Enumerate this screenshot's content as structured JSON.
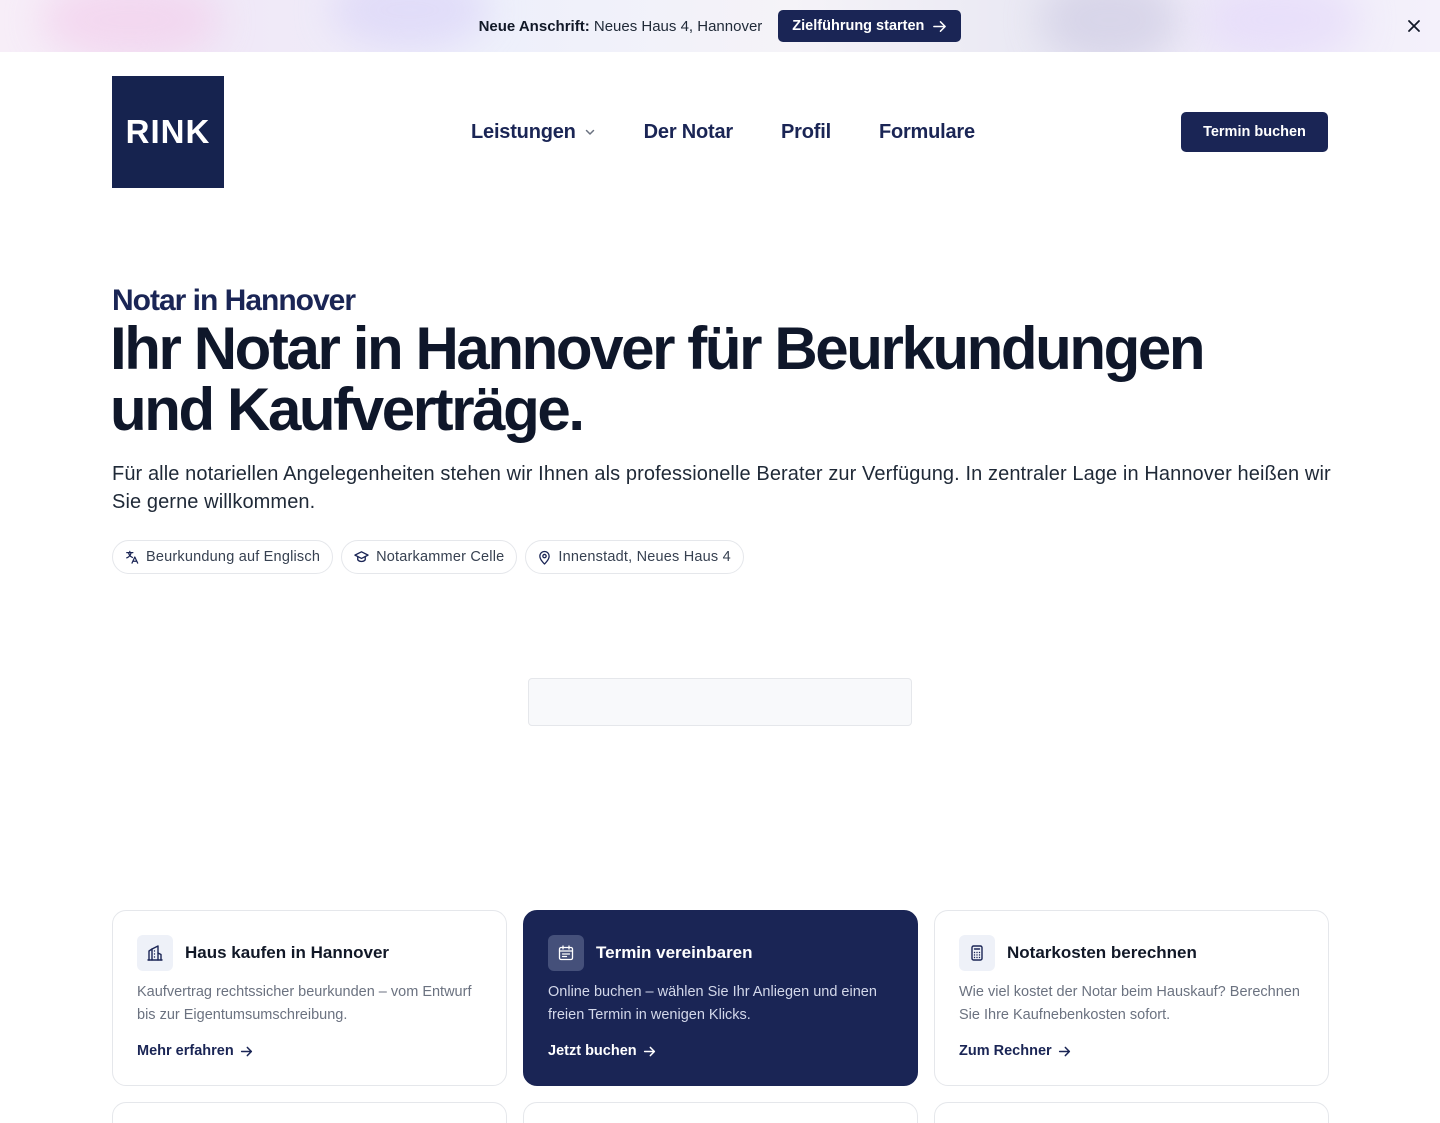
{
  "banner": {
    "label_bold": "Neue Anschrift:",
    "address": "Neues Haus 4, Hannover",
    "cta": "Zielführung starten"
  },
  "logo": {
    "text": "RINK"
  },
  "nav": {
    "items": [
      {
        "label": "Leistungen",
        "has_dropdown": true
      },
      {
        "label": "Der Notar"
      },
      {
        "label": "Profil"
      },
      {
        "label": "Formulare"
      }
    ],
    "cta": "Termin buchen"
  },
  "hero": {
    "eyebrow": "Notar in Hannover",
    "headline_line1": "Ihr Notar in Hannover für Beurkundungen",
    "headline_line2": "und Kaufverträge.",
    "lead": "Für alle notariellen Angelegenheiten stehen wir Ihnen als professionelle Berater zur Verfügung. In zentraler Lage in Hannover heißen wir Sie gerne willkommen.",
    "chips": [
      {
        "icon": "translate-icon",
        "label": "Beurkundung auf Englisch"
      },
      {
        "icon": "graduation-cap-icon",
        "label": "Notarkammer Celle"
      },
      {
        "icon": "map-pin-icon",
        "label": "Innenstadt, Neues Haus 4"
      }
    ]
  },
  "cards": [
    {
      "icon": "house-chart-icon",
      "title": "Haus kaufen in Hannover",
      "desc": "Kaufvertrag rechtssicher beurkunden – vom Entwurf bis zur Eigentumsumschreibung.",
      "link": "Mehr erfahren"
    },
    {
      "icon": "calendar-icon",
      "title": "Termin vereinbaren",
      "desc": "Online buchen – wählen Sie Ihr Anliegen und einen freien Termin in wenigen Klicks.",
      "link": "Jetzt buchen",
      "highlighted": true
    },
    {
      "icon": "calculator-icon",
      "title": "Notarkosten berechnen",
      "desc": "Wie viel kostet der Notar beim Hauskauf? Berechnen Sie Ihre Kaufnebenkosten sofort.",
      "link": "Zum Rechner"
    }
  ],
  "colors": {
    "brand_navy": "#1a2555",
    "text_dark": "#0f172a",
    "muted": "#6b7280",
    "border": "#e5e7eb"
  }
}
